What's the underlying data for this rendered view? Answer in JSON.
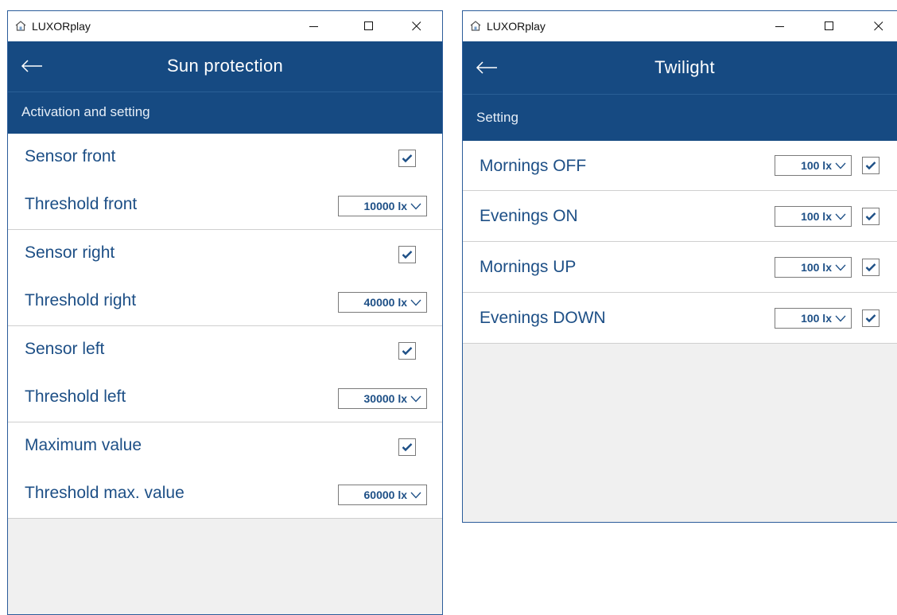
{
  "colors": {
    "header": "#164a82",
    "label": "#1d4f86",
    "window_border": "#2b5c9a"
  },
  "left_window": {
    "app_title": "LUXORplay",
    "page_title": "Sun protection",
    "section_title": "Activation and setting",
    "rows": [
      {
        "label": "Sensor front",
        "control": "checkbox",
        "checked": true
      },
      {
        "label": "Threshold front",
        "control": "select",
        "value": "10000 lx"
      },
      {
        "label": "Sensor right",
        "control": "checkbox",
        "checked": true
      },
      {
        "label": "Threshold right",
        "control": "select",
        "value": "40000 lx"
      },
      {
        "label": "Sensor left",
        "control": "checkbox",
        "checked": true
      },
      {
        "label": "Threshold left",
        "control": "select",
        "value": "30000 lx"
      },
      {
        "label": "Maximum value",
        "control": "checkbox",
        "checked": true
      },
      {
        "label": "Threshold max. value",
        "control": "select",
        "value": "60000 lx"
      }
    ]
  },
  "right_window": {
    "app_title": "LUXORplay",
    "page_title": "Twilight",
    "section_title": "Setting",
    "rows": [
      {
        "label": "Mornings OFF",
        "value": "100 lx",
        "checked": true
      },
      {
        "label": "Evenings ON",
        "value": "100 lx",
        "checked": true
      },
      {
        "label": "Mornings UP",
        "value": "100 lx",
        "checked": true
      },
      {
        "label": "Evenings DOWN",
        "value": "100 lx",
        "checked": true
      }
    ]
  },
  "icons": {
    "app": "house-icon",
    "minimize": "minimize-icon",
    "maximize": "maximize-icon",
    "close": "close-icon",
    "back": "back-arrow-icon",
    "check": "checkmark-icon",
    "dropdown": "chevron-down-icon"
  }
}
